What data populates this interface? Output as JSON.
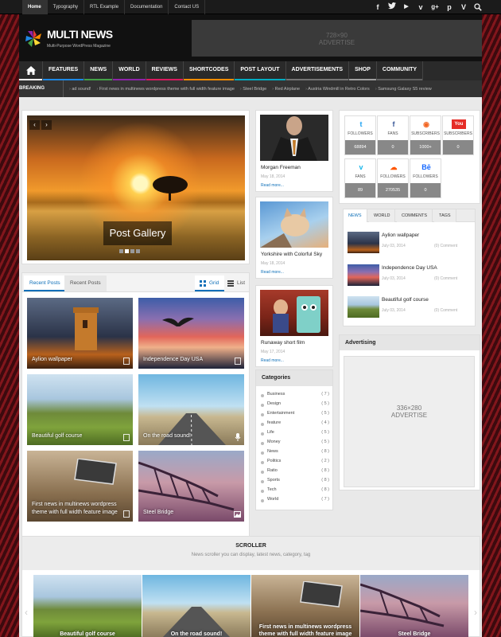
{
  "top_nav": [
    "Home",
    "Typography",
    "RTL Example",
    "Documentation",
    "Contact US"
  ],
  "social_icons": [
    "facebook-icon",
    "twitter-icon",
    "youtube-icon",
    "vimeo-icon",
    "google-plus-icon",
    "pinterest-icon",
    "vimeo-v-icon",
    "search-icon"
  ],
  "logo": {
    "title": "MULTI NEWS",
    "subtitle": "Multi-Purpose WordPress Magazine"
  },
  "header_ad": {
    "size": "728×90",
    "label": "ADVERTISE"
  },
  "main_nav": [
    {
      "label": "FEATURES",
      "color": "#1e88e5"
    },
    {
      "label": "NEWS",
      "color": "#43a047"
    },
    {
      "label": "WORLD",
      "color": "#8e24aa"
    },
    {
      "label": "REVIEWS",
      "color": "#d81b60"
    },
    {
      "label": "SHORTCODES",
      "color": "#fb8c00"
    },
    {
      "label": "POST LAYOUT",
      "color": "#00acc1"
    },
    {
      "label": "ADVERTISEMENTS",
      "color": "#757575"
    },
    {
      "label": "SHOP",
      "color": "#9e9e9e"
    },
    {
      "label": "COMMUNITY",
      "color": "#616161"
    }
  ],
  "breaking": {
    "label": "BREAKING NEWS",
    "items": [
      "ad sound!",
      "First news in multinews wordpress theme with full width feature image",
      "Steel Bridge",
      "Red Airplane",
      "Austria Windmill in Retro Colors",
      "Samsung Galaxy S5 review"
    ]
  },
  "slider": {
    "caption": "Post Gallery"
  },
  "post_tabs": {
    "tab1": "Recent Posts",
    "tab2": "Recent Posts",
    "grid": "Grid",
    "list": "List"
  },
  "grid_posts": [
    "Aylion wallpaper",
    "Independence Day USA",
    "Beautiful golf course",
    "On the road sound!",
    "First news in multinews wordpress theme with full width feature image",
    "Steel Bridge"
  ],
  "mid_posts": [
    {
      "title": "Morgan Freeman",
      "date": "May 18, 2014",
      "more": "Read more..."
    },
    {
      "title": "Yorkshire with Colorful Sky",
      "date": "May 18, 2014",
      "more": "Read more..."
    },
    {
      "title": "Runaway short film",
      "date": "May 17, 2014",
      "more": "Read more..."
    }
  ],
  "categories": {
    "title": "Categories",
    "items": [
      {
        "name": "Business",
        "count": "( 7 )"
      },
      {
        "name": "Design",
        "count": "( 5 )"
      },
      {
        "name": "Entertainment",
        "count": "( 5 )"
      },
      {
        "name": "feature",
        "count": "( 4 )"
      },
      {
        "name": "Life",
        "count": "( 5 )"
      },
      {
        "name": "Money",
        "count": "( 5 )"
      },
      {
        "name": "News",
        "count": "( 8 )"
      },
      {
        "name": "Politics",
        "count": "( 2 )"
      },
      {
        "name": "Ratio",
        "count": "( 8 )"
      },
      {
        "name": "Sports",
        "count": "( 8 )"
      },
      {
        "name": "Tech",
        "count": "( 8 )"
      },
      {
        "name": "World",
        "count": "( 7 )"
      }
    ]
  },
  "social_counts": [
    {
      "icon": "twitter-icon",
      "glyph": "t",
      "color": "#1da1f2",
      "label": "FOLLOWERS",
      "count": "68894"
    },
    {
      "icon": "facebook-icon",
      "glyph": "f",
      "color": "#3b5998",
      "label": "FANS",
      "count": "0"
    },
    {
      "icon": "rss-icon",
      "glyph": "◉",
      "color": "#f26522",
      "label": "SUBSCRIBERS",
      "count": "1000+"
    },
    {
      "icon": "youtube-icon",
      "glyph": "You",
      "color": "#e52d27",
      "label": "SUBSCRIBERS",
      "count": "0"
    },
    {
      "icon": "vimeo-icon",
      "glyph": "v",
      "color": "#1ab7ea",
      "label": "FANS",
      "count": "89"
    },
    {
      "icon": "soundcloud-icon",
      "glyph": "☁",
      "color": "#ff5500",
      "label": "FOLLOWERS",
      "count": "270535"
    },
    {
      "icon": "behance-icon",
      "glyph": "Bē",
      "color": "#1769ff",
      "label": "FOLLOWERS",
      "count": "0"
    }
  ],
  "right_tabs": [
    "NEWS",
    "WORLD",
    "COMMENTS",
    "TAGS"
  ],
  "right_posts": [
    {
      "title": "Aylion wallpaper",
      "date": "July 03, 2014",
      "comments": "(0) Comment"
    },
    {
      "title": "Independence Day USA",
      "date": "July 03, 2014",
      "comments": "(0) Comment"
    },
    {
      "title": "Beautiful golf course",
      "date": "July 03, 2014",
      "comments": "(0) Comment"
    }
  ],
  "advertising": {
    "title": "Advertising",
    "size": "336×280",
    "label": "ADVERTISE"
  },
  "scroller": {
    "title": "SCROLLER",
    "subtitle": "News scroller you can display, latest news, category, tag",
    "items": [
      "Beautiful golf course",
      "On the road sound!",
      "First news in multinews wordpress theme with full width feature image",
      "Steel Bridge"
    ]
  }
}
